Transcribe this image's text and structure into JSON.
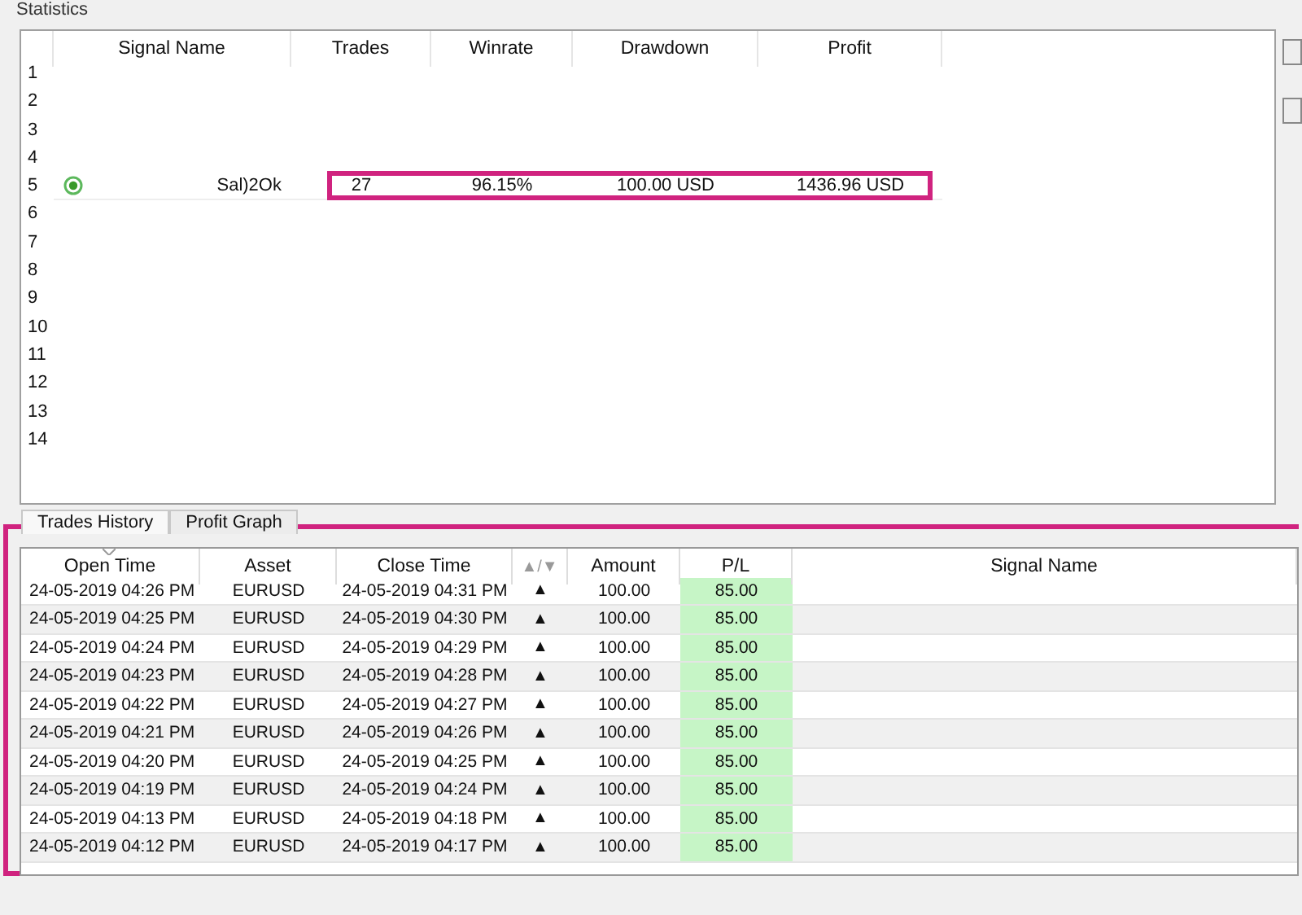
{
  "window": {
    "title": "Statistics"
  },
  "statistics": {
    "columns": [
      "Signal Name",
      "Trades",
      "Winrate",
      "Drawdown",
      "Profit"
    ],
    "rows": [
      {
        "number": "1",
        "highlighted": false
      },
      {
        "number": "2",
        "highlighted": false
      },
      {
        "number": "3",
        "highlighted": false
      },
      {
        "number": "4",
        "highlighted": false
      },
      {
        "number": "5",
        "highlighted": true,
        "signal_name": "Sal)2Ok",
        "trades": "27",
        "winrate": "96.15%",
        "drawdown": "100.00 USD",
        "profit": "1436.96 USD"
      },
      {
        "number": "6",
        "highlighted": false
      },
      {
        "number": "7",
        "highlighted": false
      },
      {
        "number": "8",
        "highlighted": false
      },
      {
        "number": "9",
        "highlighted": false
      },
      {
        "number": "10",
        "highlighted": false
      },
      {
        "number": "11",
        "highlighted": false
      },
      {
        "number": "12",
        "highlighted": false
      },
      {
        "number": "13",
        "highlighted": false
      },
      {
        "number": "14",
        "highlighted": false
      }
    ]
  },
  "trades": {
    "highlighted": true,
    "tabs": [
      {
        "label": "Trades History",
        "selected": true
      },
      {
        "label": "Profit Graph",
        "selected": false
      }
    ],
    "columns": [
      "Open Time",
      "Asset",
      "Close Time",
      "▲/▼",
      "Amount",
      "P/L",
      "Signal Name"
    ],
    "rows": [
      {
        "open_time": "24-05-2019 04:26 PM",
        "asset": "EURUSD",
        "close_time": "24-05-2019 04:31 PM",
        "direction": "▲",
        "amount": "100.00",
        "pl": "85.00"
      },
      {
        "open_time": "24-05-2019 04:25 PM",
        "asset": "EURUSD",
        "close_time": "24-05-2019 04:30 PM",
        "direction": "▲",
        "amount": "100.00",
        "pl": "85.00"
      },
      {
        "open_time": "24-05-2019 04:24 PM",
        "asset": "EURUSD",
        "close_time": "24-05-2019 04:29 PM",
        "direction": "▲",
        "amount": "100.00",
        "pl": "85.00"
      },
      {
        "open_time": "24-05-2019 04:23 PM",
        "asset": "EURUSD",
        "close_time": "24-05-2019 04:28 PM",
        "direction": "▲",
        "amount": "100.00",
        "pl": "85.00"
      },
      {
        "open_time": "24-05-2019 04:22 PM",
        "asset": "EURUSD",
        "close_time": "24-05-2019 04:27 PM",
        "direction": "▲",
        "amount": "100.00",
        "pl": "85.00"
      },
      {
        "open_time": "24-05-2019 04:21 PM",
        "asset": "EURUSD",
        "close_time": "24-05-2019 04:26 PM",
        "direction": "▲",
        "amount": "100.00",
        "pl": "85.00"
      },
      {
        "open_time": "24-05-2019 04:20 PM",
        "asset": "EURUSD",
        "close_time": "24-05-2019 04:25 PM",
        "direction": "▲",
        "amount": "100.00",
        "pl": "85.00"
      },
      {
        "open_time": "24-05-2019 04:19 PM",
        "asset": "EURUSD",
        "close_time": "24-05-2019 04:24 PM",
        "direction": "▲",
        "amount": "100.00",
        "pl": "85.00"
      },
      {
        "open_time": "24-05-2019 04:13 PM",
        "asset": "EURUSD",
        "close_time": "24-05-2019 04:18 PM",
        "direction": "▲",
        "amount": "100.00",
        "pl": "85.00"
      },
      {
        "open_time": "24-05-2019 04:12 PM",
        "asset": "EURUSD",
        "close_time": "24-05-2019 04:17 PM",
        "direction": "▲",
        "amount": "100.00",
        "pl": "85.00"
      }
    ]
  }
}
